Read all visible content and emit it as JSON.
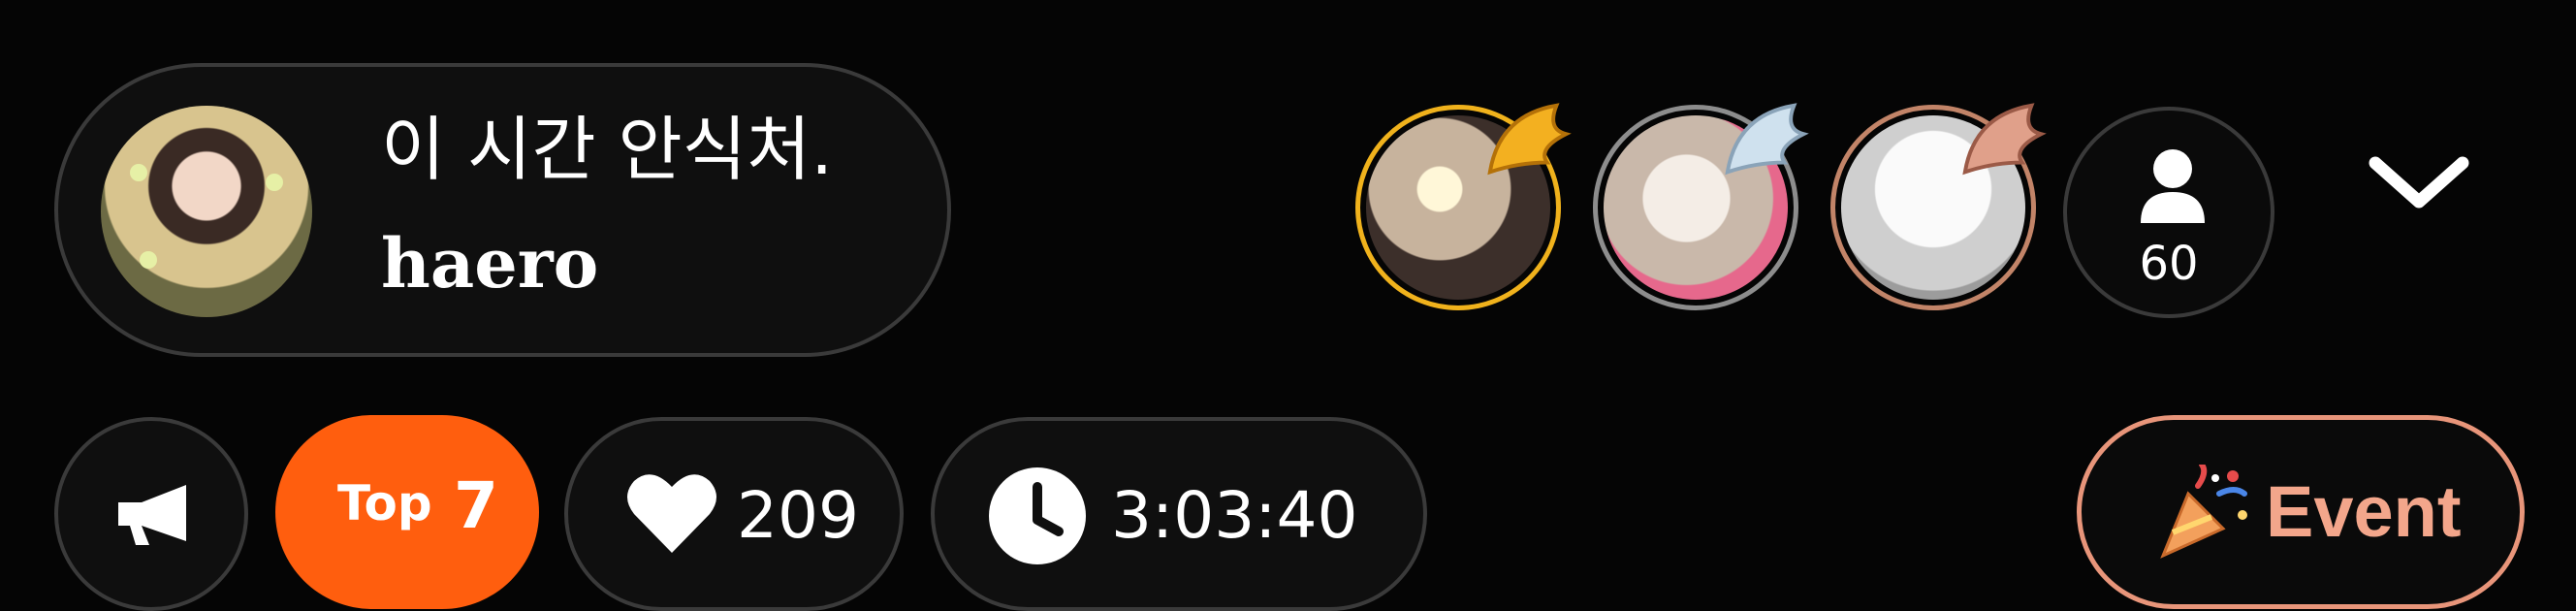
{
  "host": {
    "title": "이 시간 안식처.",
    "name": "haero"
  },
  "viewers": {
    "avatars": [
      {
        "name": "viewer-1",
        "ring_color": "#f0b21c",
        "badge": "gold-wing-icon"
      },
      {
        "name": "viewer-2",
        "ring_color": "#8d8d8d",
        "badge": "silver-wing-icon"
      },
      {
        "name": "viewer-3",
        "ring_color": "#c28468",
        "badge": "bronze-wing-icon"
      }
    ],
    "count": "60"
  },
  "toolbar": {
    "rank_label": "Top",
    "rank_value": "7",
    "likes": "209",
    "timer": "3:03:40",
    "event_label": "Event"
  },
  "colors": {
    "accent": "#ff5e0e",
    "event": "#f3a68b",
    "background": "#050505"
  }
}
